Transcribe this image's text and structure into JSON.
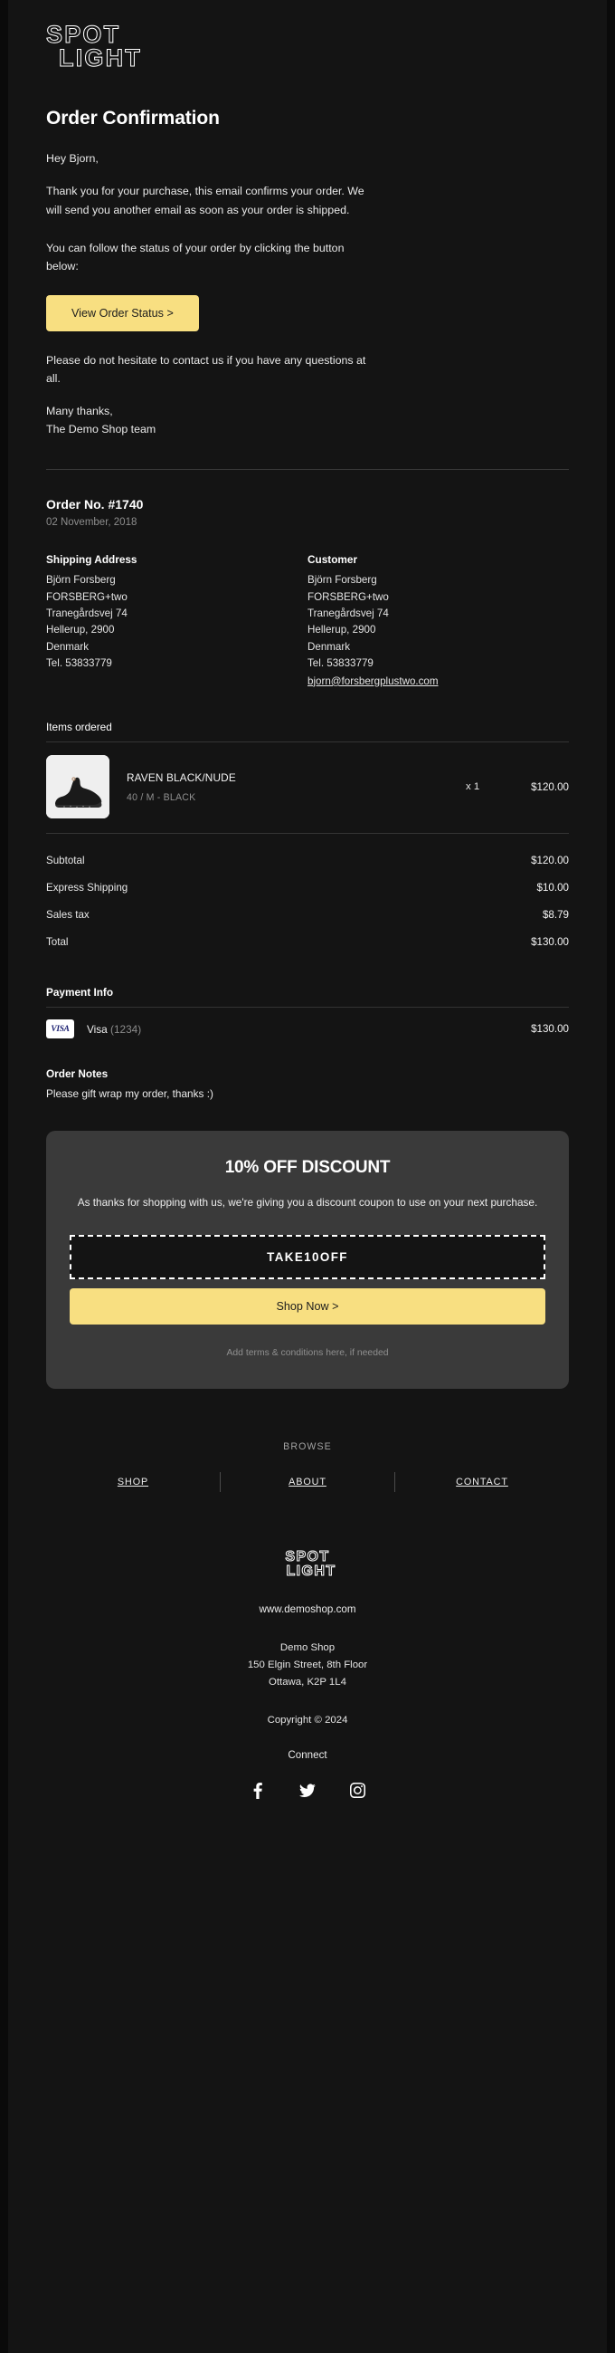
{
  "brand": {
    "logo_line1": "SPOT",
    "logo_line2": "LIGHT",
    "accent_yellow": "#F8DF81",
    "background": "#141414",
    "promo_background": "#3A3A3A"
  },
  "header": {
    "title": "Order Confirmation"
  },
  "intro": {
    "greeting": "Hey Bjorn,",
    "paragraph1": "Thank you for your purchase, this email confirms your order. We will send you another email as soon as your order is shipped.",
    "paragraph2": "You can follow the status of your order by clicking the button below:",
    "cta_label": "View Order Status >",
    "paragraph3": "Please do not hesitate to contact us if you have any questions at all.",
    "signoff_line1": "Many thanks,",
    "signoff_line2": "The Demo Shop team"
  },
  "order": {
    "number_label": "Order No. #1740",
    "date": "02 November, 2018",
    "shipping": {
      "heading": "Shipping Address",
      "lines": [
        "Björn Forsberg",
        "FORSBERG+two",
        "Tranegårdsvej 74",
        "Hellerup, 2900",
        "Denmark",
        "Tel. 53833779"
      ]
    },
    "customer": {
      "heading": "Customer",
      "lines": [
        "Björn Forsberg",
        "FORSBERG+two",
        "Tranegårdsvej 74",
        "Hellerup, 2900",
        "Denmark",
        "Tel. 53833779"
      ],
      "email": "bjorn@forsbergplustwo.com"
    }
  },
  "items": {
    "heading": "Items ordered",
    "rows": [
      {
        "name": "RAVEN BLACK/NUDE",
        "variant": "40 / M - BLACK",
        "qty": "x 1",
        "price": "$120.00",
        "image_alt": "black-sneaker-photo"
      }
    ]
  },
  "totals": [
    {
      "label": "Subtotal",
      "value": "$120.00"
    },
    {
      "label": "Express Shipping",
      "value": "$10.00"
    },
    {
      "label": "Sales tax",
      "value": "$8.79"
    },
    {
      "label": "Total",
      "value": "$130.00"
    }
  ],
  "payment": {
    "heading": "Payment Info",
    "card_brand": "Visa",
    "card_last4": "(1234)",
    "card_logo_text": "VISA",
    "amount": "$130.00"
  },
  "notes": {
    "heading": "Order Notes",
    "text": "Please gift wrap my order, thanks :)"
  },
  "promo": {
    "title": "10% OFF DISCOUNT",
    "subtitle": "As thanks for shopping with us, we're giving you a discount coupon to use on your next purchase.",
    "coupon_code": "TAKE10OFF",
    "cta_label": "Shop Now >",
    "terms": "Add terms & conditions here, if needed"
  },
  "footer": {
    "browse_label": "BROWSE",
    "nav": [
      {
        "label": "SHOP"
      },
      {
        "label": "ABOUT"
      },
      {
        "label": "CONTACT"
      }
    ],
    "logo_line1": "SPOT",
    "logo_line2": "LIGHT",
    "website": "www.demoshop.com",
    "shop_name": "Demo Shop",
    "address_line1": "150 Elgin Street, 8th Floor",
    "address_line2": "Ottawa, K2P 1L4",
    "copyright": "Copyright © 2024",
    "connect_label": "Connect",
    "socials": [
      {
        "name": "facebook-icon"
      },
      {
        "name": "twitter-icon"
      },
      {
        "name": "instagram-icon"
      }
    ]
  }
}
